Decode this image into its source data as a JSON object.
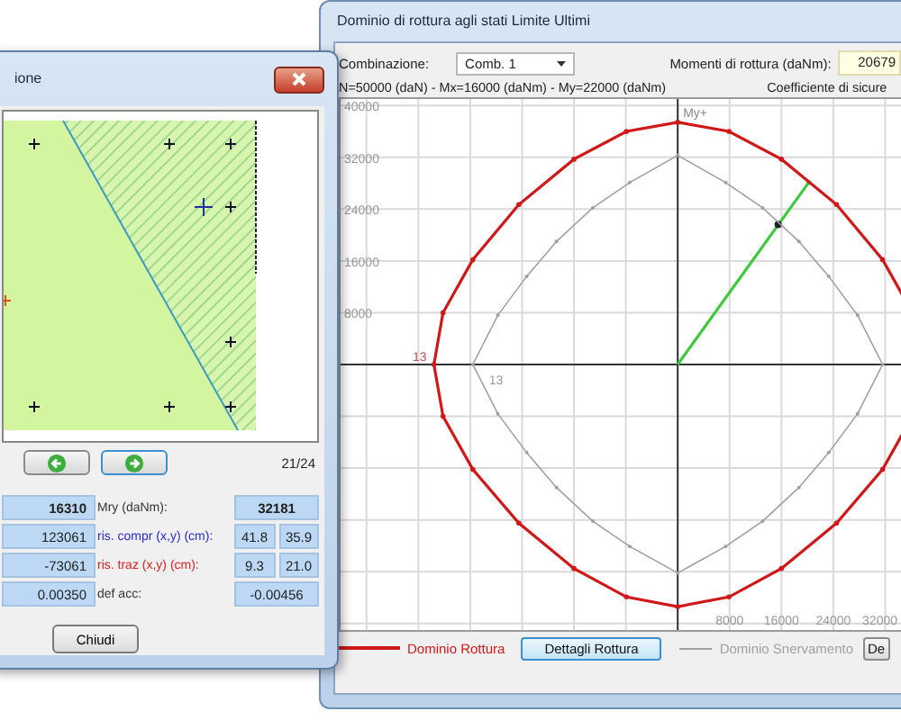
{
  "back_window": {
    "title": "Dominio di rottura agli stati Limite Ultimi",
    "combination_label": "Combinazione:",
    "combination": "Comb. 1",
    "moments_label": "Momenti di rottura (daNm):",
    "moments_value": "20679",
    "forces": "N=50000 (daN) - Mx=16000 (daNm) - My=22000 (daNm)",
    "safety_label": "Coefficiente di sicure",
    "chart_data": {
      "type": "line",
      "grid": true,
      "xlim": [
        -52000,
        40000
      ],
      "ylim": [
        -41000,
        41000
      ],
      "xticks": [
        {
          "value": 8000,
          "label": "8000"
        },
        {
          "value": 16000,
          "label": "16000"
        },
        {
          "value": 24000,
          "label": "24000"
        },
        {
          "value": 32000,
          "label": "32000"
        }
      ],
      "yticks": [
        8000,
        16000,
        24000,
        32000,
        40000
      ],
      "series": [
        {
          "color": "#40c840",
          "marker": true,
          "x": [
            0,
            20200
          ],
          "values": [
            0,
            28100
          ]
        },
        {
          "color": "#202020",
          "marker": true,
          "x": [
            15500
          ],
          "values": [
            21600
          ]
        }
      ],
      "annotations": [
        "My+",
        "13",
        "13"
      ]
    },
    "footer": [
      {
        "kind": "legend",
        "label": "Dominio Rottura",
        "color": "#d01818"
      },
      {
        "kind": "button",
        "label": "Dettagli Rottura",
        "selected": true
      },
      {
        "kind": "legend",
        "label": "Dominio Snervamento",
        "color": "#a0a0a0"
      },
      {
        "kind": "button",
        "label": "De",
        "selected": false
      }
    ]
  },
  "front_window": {
    "title": "ione",
    "counter": "21/24",
    "rows": [
      {
        "value": "16310",
        "label": "Mry (daNm):",
        "color": "#333333",
        "results": [
          "32181"
        ],
        "bold": true
      },
      {
        "value": "123061",
        "label": "ris. compr (x,y) (cm):",
        "color": "#2a2ad0",
        "results": [
          "41.8",
          "35.9"
        ],
        "bold": false
      },
      {
        "value": "-73061",
        "label": "ris. traz (x,y) (cm):",
        "color": "#e02020",
        "results": [
          "9.3",
          "21.0"
        ],
        "bold": false
      },
      {
        "value": "0.00350",
        "label": "def acc:",
        "color": "#333333",
        "results": [
          "-0.00456"
        ],
        "bold": false
      }
    ],
    "close_button": "Chiudi"
  }
}
